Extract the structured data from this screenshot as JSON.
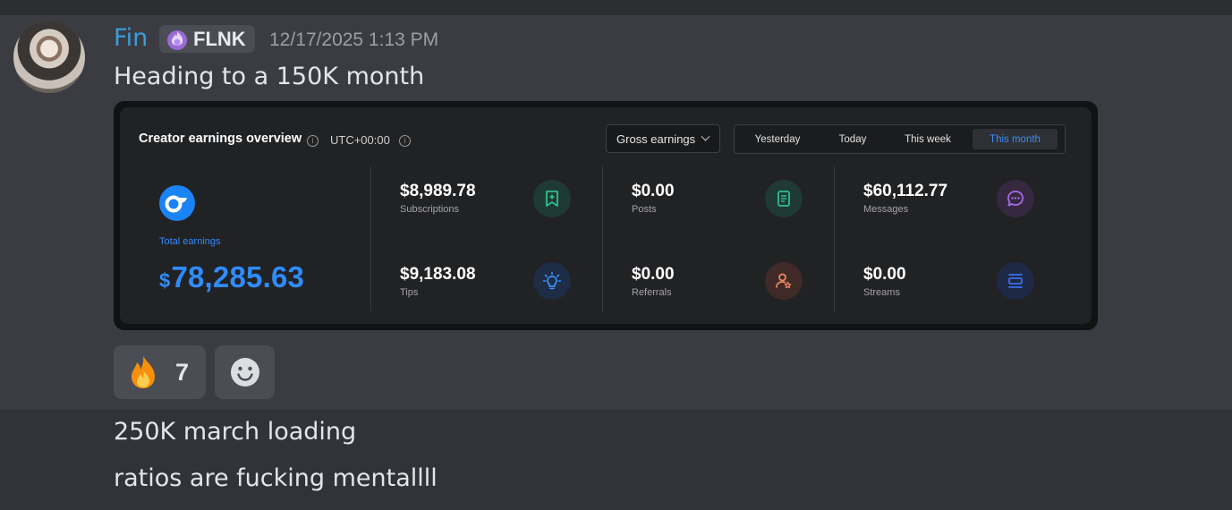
{
  "message": {
    "author": "Fin",
    "tag": "FLNK",
    "timestamp": "12/17/2025 1:13 PM",
    "text": "Heading to a 150K month"
  },
  "dashboard": {
    "title": "Creator earnings overview",
    "timezone": "UTC+00:00",
    "select_value": "Gross earnings",
    "periods": [
      "Yesterday",
      "Today",
      "This week",
      "This month"
    ],
    "active_period": "This month",
    "total": {
      "label": "Total earnings",
      "currency": "$",
      "value": "78,285.63"
    },
    "stats": [
      {
        "value": "$8,989.78",
        "label": "Subscriptions",
        "icon": "subscriptions-icon",
        "color": "#2fbf8f"
      },
      {
        "value": "$0.00",
        "label": "Posts",
        "icon": "posts-icon",
        "color": "#2fbf8f"
      },
      {
        "value": "$60,112.77",
        "label": "Messages",
        "icon": "messages-icon",
        "color": "#a66be6"
      },
      {
        "value": "$9,183.08",
        "label": "Tips",
        "icon": "tips-icon",
        "color": "#3a8ef6"
      },
      {
        "value": "$0.00",
        "label": "Referrals",
        "icon": "referrals-icon",
        "color": "#ef8a60"
      },
      {
        "value": "$0.00",
        "label": "Streams",
        "icon": "streams-icon",
        "color": "#3a6ff0"
      }
    ]
  },
  "reactions": [
    {
      "emoji": "fire-icon",
      "count": "7"
    }
  ],
  "followups": [
    "250K march loading",
    "ratios are fucking mentallll"
  ],
  "colors": {
    "background": "#313338",
    "username": "#3b9ede",
    "accent_blue": "#2f8cff"
  }
}
